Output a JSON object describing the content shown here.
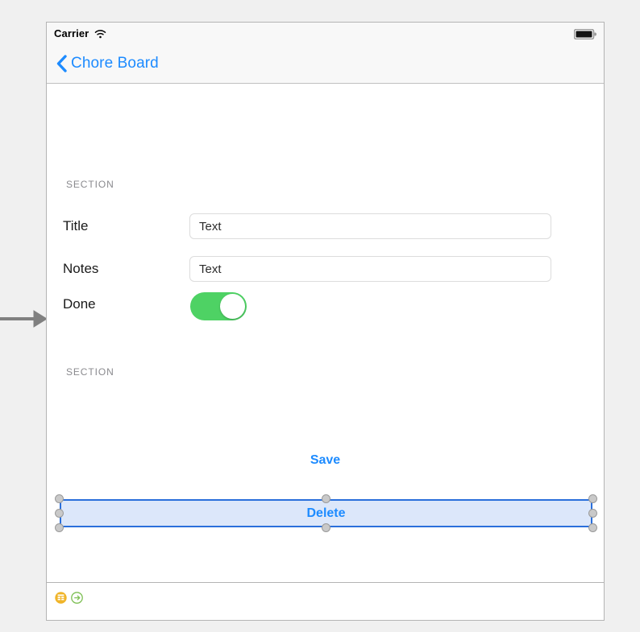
{
  "canvas": {
    "background_color": "#f0f0f0",
    "device_background": "#ffffff"
  },
  "annotation": {
    "arrow_icon": "arrow-right-icon",
    "color": "#808080"
  },
  "status_bar": {
    "carrier": "Carrier",
    "wifi_icon": "wifi-icon",
    "battery_icon": "battery-full-icon",
    "background_color": "#f8f8f8"
  },
  "nav_bar": {
    "back_chevron_icon": "chevron-left-icon",
    "back_title": "Chore Board",
    "tint_color": "#1d8bff"
  },
  "form": {
    "sections": [
      {
        "header": "SECTION"
      },
      {
        "header": "SECTION"
      }
    ],
    "rows": [
      {
        "label": "Title",
        "value": "",
        "placeholder": "Text",
        "control": "textfield"
      },
      {
        "label": "Notes",
        "value": "",
        "placeholder": "Text",
        "control": "textfield"
      },
      {
        "label": "Done",
        "control": "switch",
        "switch_on": true,
        "switch_on_color": "#4ed264"
      }
    ]
  },
  "actions": {
    "save_label": "Save",
    "delete_label": "Delete",
    "tint_color": "#1d8bff",
    "selection": {
      "selected_element": "delete-button",
      "border_color": "#2a6fdb",
      "fill_color": "#dce7fa",
      "handle_color": "#c9c9c9",
      "handle_count": 8
    }
  },
  "dock_bar": {
    "icons": [
      {
        "name": "table-view-controller-icon",
        "color": "#f0b429"
      },
      {
        "name": "exit-segue-icon",
        "color": "#7dbf53"
      }
    ]
  }
}
